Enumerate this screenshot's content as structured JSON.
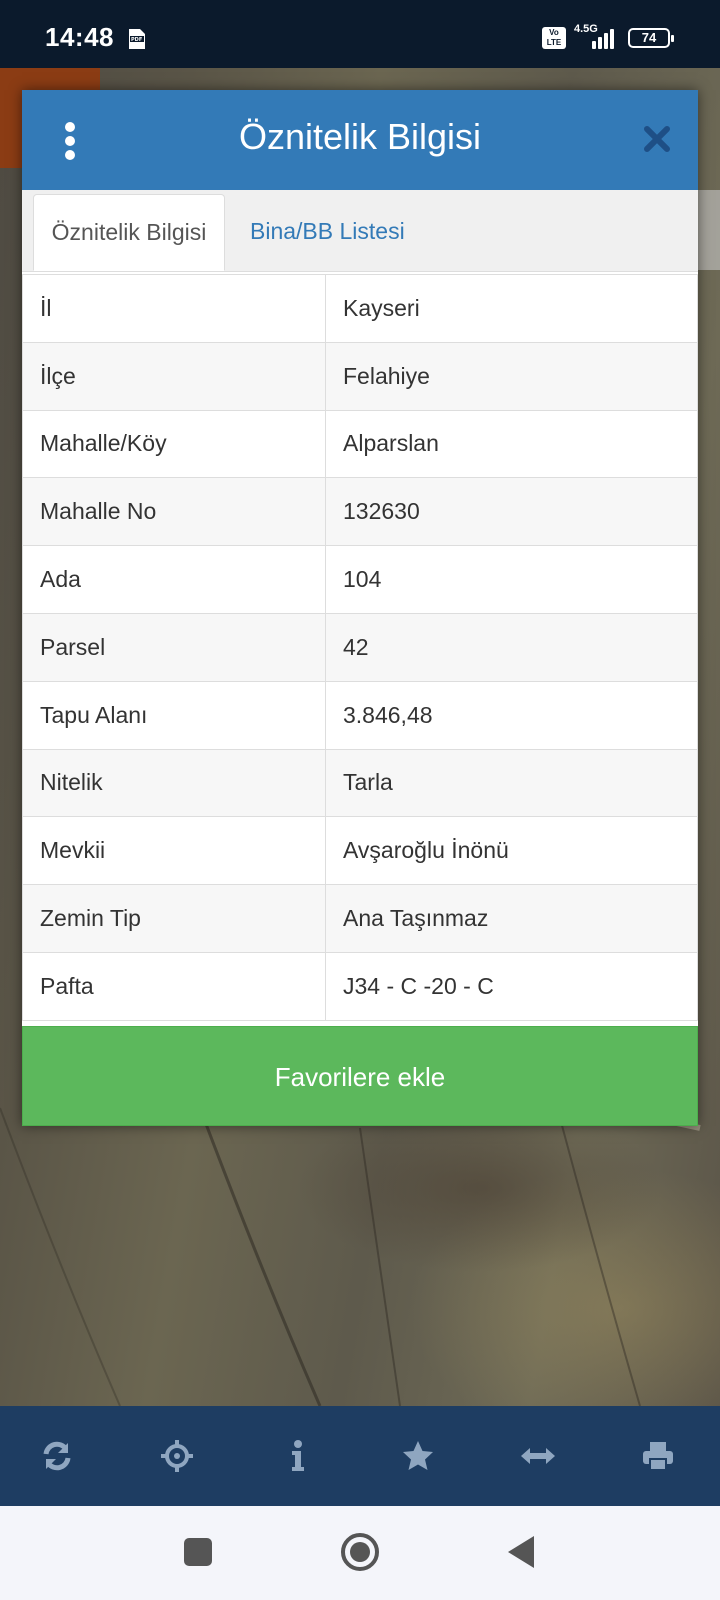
{
  "status_bar": {
    "time": "14:48",
    "network": "4.5G",
    "volte": "Vo LTE",
    "battery": "74",
    "icons": [
      "pdf-icon",
      "volte-icon",
      "signal-icon",
      "battery-icon"
    ]
  },
  "modal": {
    "title": "Öznitelik Bilgisi",
    "tabs": [
      {
        "label": "Öznitelik Bilgisi",
        "active": true
      },
      {
        "label": "Bina/BB Listesi",
        "active": false
      }
    ],
    "rows": [
      {
        "key": "İl",
        "value": "Kayseri"
      },
      {
        "key": "İlçe",
        "value": "Felahiye"
      },
      {
        "key": "Mahalle/Köy",
        "value": "Alparslan"
      },
      {
        "key": "Mahalle No",
        "value": "132630"
      },
      {
        "key": "Ada",
        "value": "104"
      },
      {
        "key": "Parsel",
        "value": "42"
      },
      {
        "key": "Tapu Alanı",
        "value": "3.846,48"
      },
      {
        "key": "Nitelik",
        "value": "Tarla"
      },
      {
        "key": "Mevkii",
        "value": "Avşaroğlu İnönü"
      },
      {
        "key": "Zemin Tip",
        "value": "Ana Taşınmaz"
      },
      {
        "key": "Pafta",
        "value": "J34 - C -20 - C"
      }
    ],
    "favorite_button": "Favorilere ekle"
  },
  "toolbar": {
    "icons": [
      "refresh-icon",
      "locate-icon",
      "info-icon",
      "star-icon",
      "measure-icon",
      "print-icon"
    ]
  },
  "nav_bar": {
    "icons": [
      "recents-icon",
      "home-icon",
      "back-icon"
    ]
  },
  "colors": {
    "header_blue": "#337ab7",
    "button_green": "#5cb85c",
    "toolbar_navy": "#1e3d62",
    "status_bar": "#0b1a2c"
  }
}
